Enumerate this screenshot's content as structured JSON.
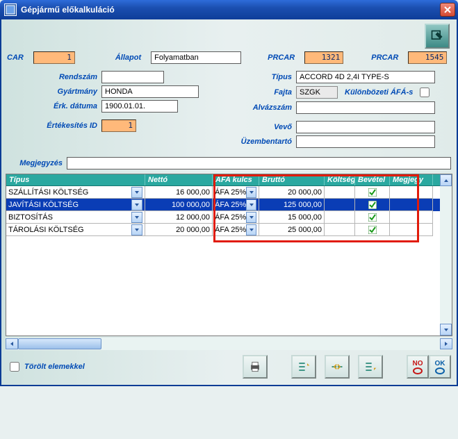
{
  "window": {
    "title": "Gépjármű előkalkuláció"
  },
  "header": {
    "car_label": "CAR",
    "car_value": "1",
    "allapot_label": "Állapot",
    "allapot_value": "Folyamatban",
    "prcar1_label": "PRCAR",
    "prcar1_value": "1321",
    "prcar2_label": "PRCAR",
    "prcar2_value": "1545"
  },
  "left": {
    "rendszam_label": "Rendszám",
    "rendszam_value": "",
    "gyartmany_label": "Gyártmány",
    "gyartmany_value": "HONDA",
    "erk_label": "Érk. dátuma",
    "erk_value": "1900.01.01.",
    "ertid_label": "Értékesítés ID",
    "ertid_value": "1"
  },
  "right": {
    "tipus_label": "Típus",
    "tipus_value": "ACCORD 4D 2,4I TYPE-S",
    "fajta_label": "Fajta",
    "fajta_value": "SZGK",
    "kulon_label": "Különbözeti ÁFÁ-s",
    "alvaz_label": "Alvázszám",
    "alvaz_value": "",
    "vevo_label": "Vevő",
    "vevo_value": "",
    "uzem_label": "Üzembentartó",
    "uzem_value": ""
  },
  "comment_label": "Megjegyzés",
  "comment_value": "",
  "table": {
    "headers": [
      "Típus",
      "Nettó",
      "ÁFA kulcs",
      "Bruttó",
      "Költség",
      "Bevétel",
      "Megjegy"
    ],
    "rows": [
      {
        "tipus": "SZÁLLÍTÁSI KÖLTSÉG",
        "netto": "16 000,00",
        "afa": "ÁFA 25%",
        "brutto": "20 000,00",
        "bevetel": true,
        "sel": false
      },
      {
        "tipus": "JAVÍTÁSI KÖLTSÉG",
        "netto": "100 000,00",
        "afa": "ÁFA 25%",
        "brutto": "125 000,00",
        "bevetel": true,
        "sel": true
      },
      {
        "tipus": "BIZTOSÍTÁS",
        "netto": "12 000,00",
        "afa": "ÁFA 25%",
        "brutto": "15 000,00",
        "bevetel": true,
        "sel": false
      },
      {
        "tipus": "TÁROLÁSI KÖLTSÉG",
        "netto": "20 000,00",
        "afa": "ÁFA 25%",
        "brutto": "25 000,00",
        "bevetel": true,
        "sel": false
      }
    ]
  },
  "footer": {
    "torolt_label": "Törölt elemekkel",
    "no_label": "NO",
    "ok_label": "OK"
  }
}
